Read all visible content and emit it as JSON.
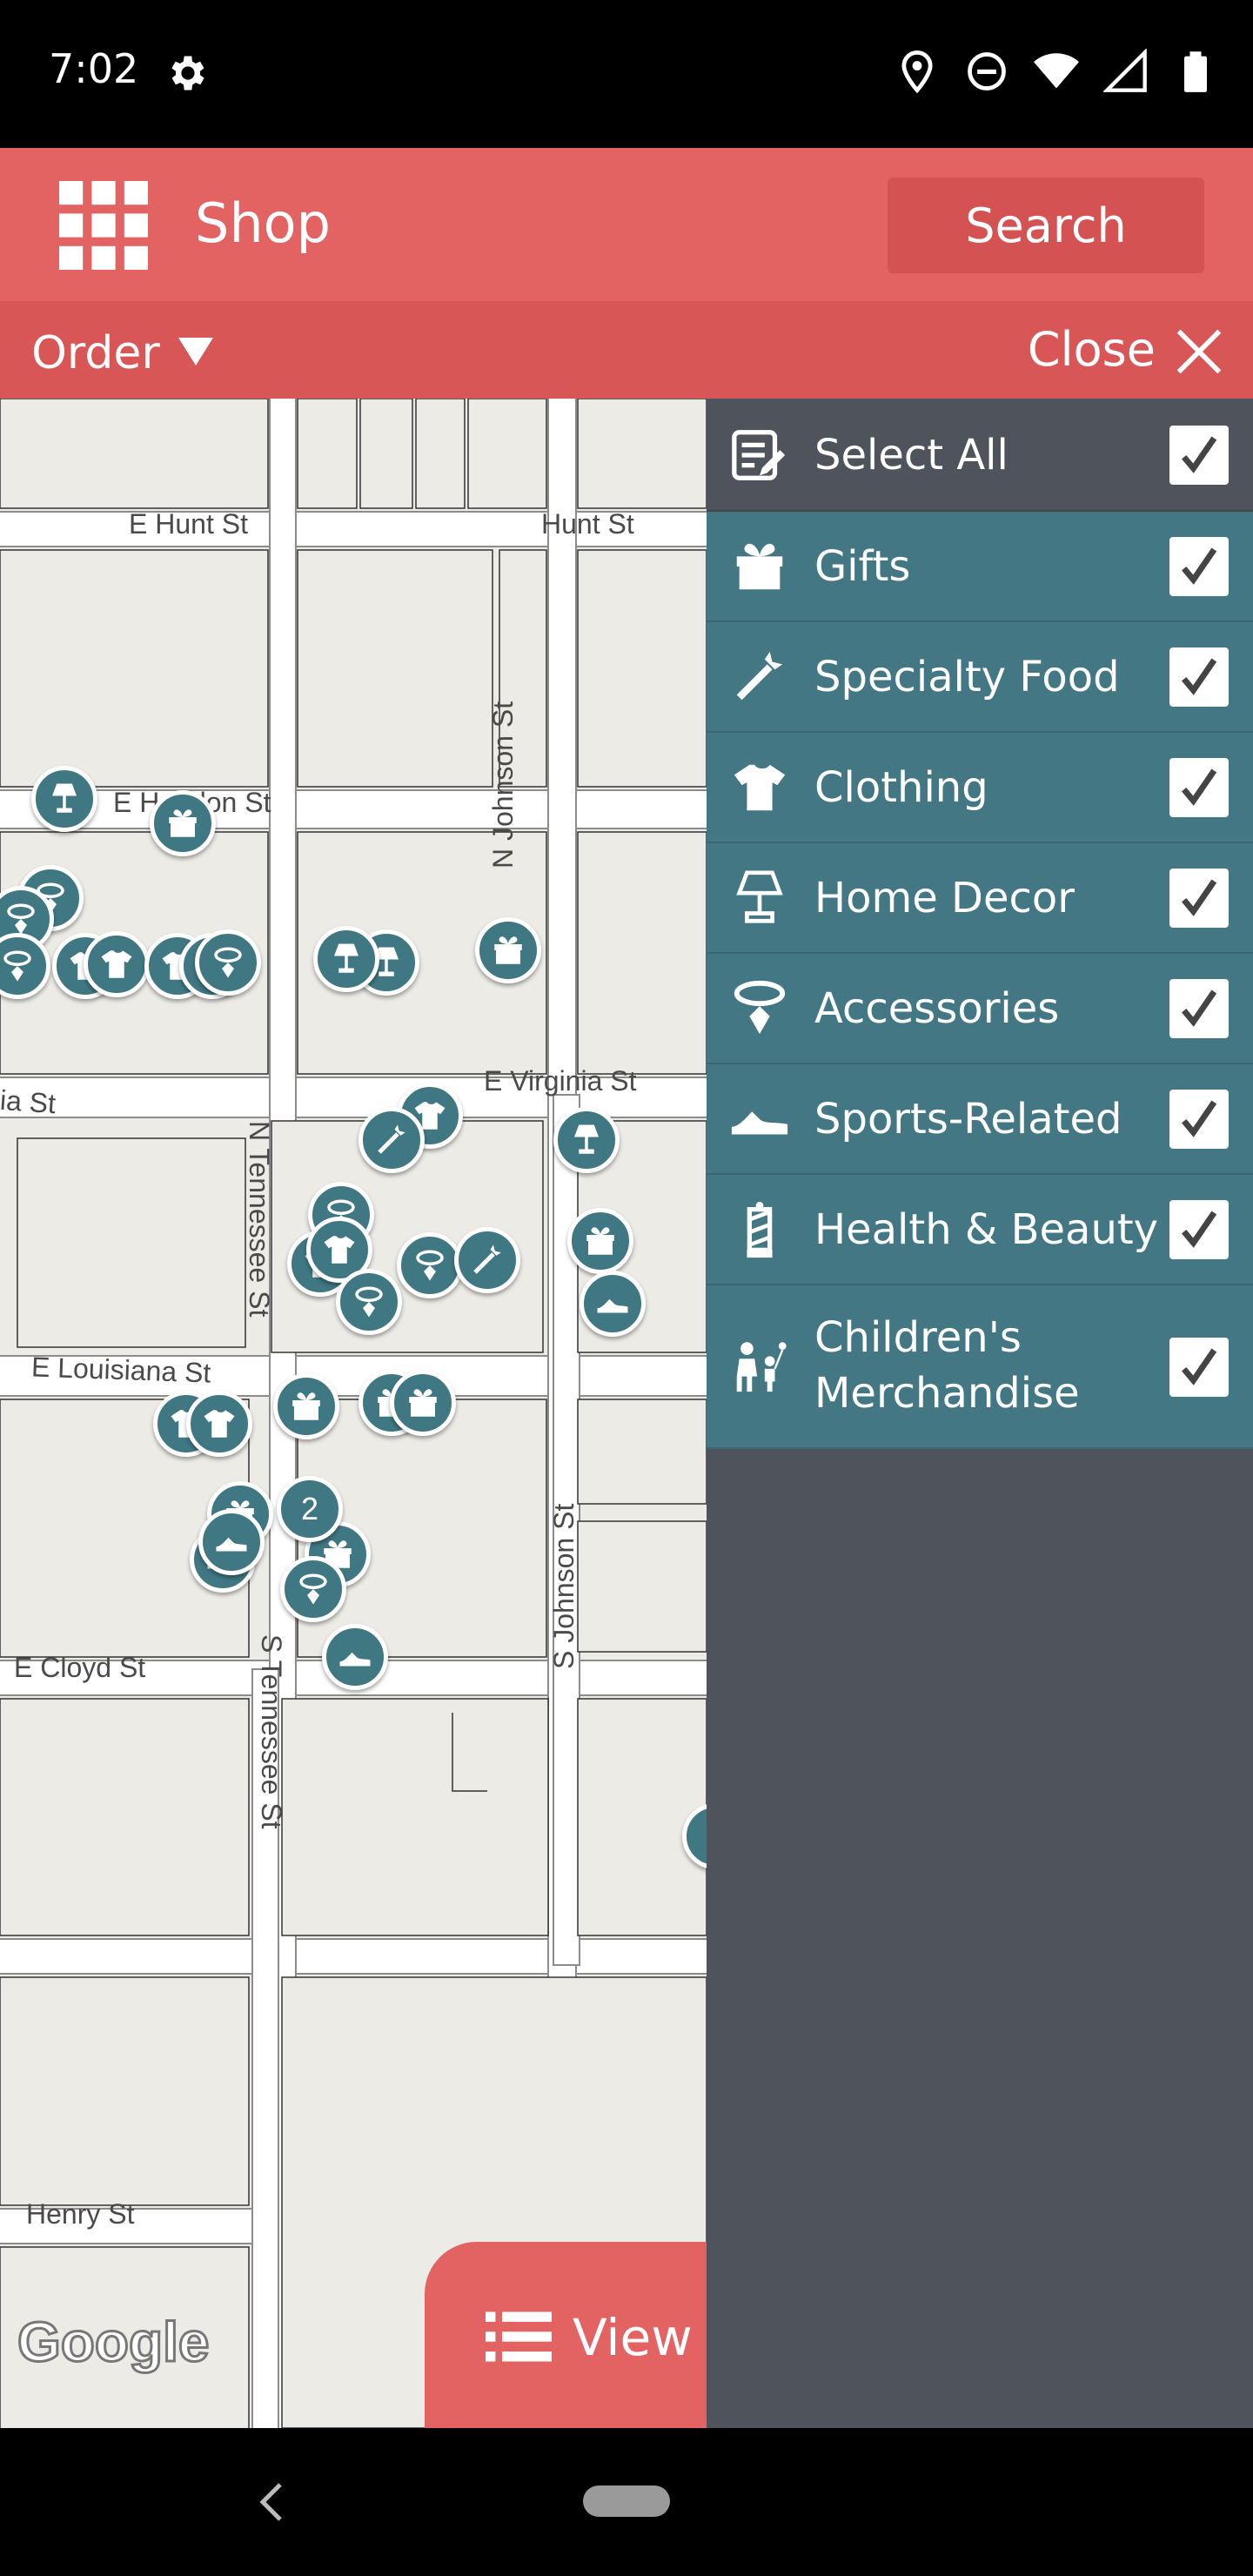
{
  "status_bar": {
    "time": "7:02"
  },
  "header": {
    "title": "Shop",
    "search_label": "Search"
  },
  "toolbar": {
    "order_label": "Order",
    "close_label": "Close"
  },
  "map": {
    "streets": [
      "E Hunt St",
      "Hunt St",
      "E Hendon St",
      "N Johnson St",
      "E Virginia St",
      "ia St",
      "N Tennessee St",
      "E Louisiana St",
      "S Johnson St",
      "E Cloyd St",
      "S Tennessee St",
      "Henry St"
    ],
    "cluster_count": "2",
    "attribution": "Google",
    "view_list_label": "View L"
  },
  "filter_panel": {
    "select_all": {
      "label": "Select All",
      "checked": true,
      "icon": "list-edit-icon"
    },
    "categories": [
      {
        "label": "Gifts",
        "checked": true,
        "icon": "gift-icon"
      },
      {
        "label": "Specialty Food",
        "checked": true,
        "icon": "carrot-icon"
      },
      {
        "label": "Clothing",
        "checked": true,
        "icon": "tshirt-icon"
      },
      {
        "label": "Home Decor",
        "checked": true,
        "icon": "lamp-icon"
      },
      {
        "label": "Accessories",
        "checked": true,
        "icon": "necklace-icon"
      },
      {
        "label": "Sports-Related",
        "checked": true,
        "icon": "sneaker-icon"
      },
      {
        "label": "Health & Beauty",
        "checked": true,
        "icon": "barber-pole-icon"
      },
      {
        "label": "Children's Merchandise",
        "label_line1": "Children's",
        "label_line2": "Merchandise",
        "checked": true,
        "icon": "family-icon"
      }
    ]
  },
  "colors": {
    "header": "#e36262",
    "toolbar": "#d95656",
    "panel_row": "#427783",
    "panel_bg": "#4f535c",
    "pin": "#3f7783",
    "map_bg": "#ecebe6"
  }
}
